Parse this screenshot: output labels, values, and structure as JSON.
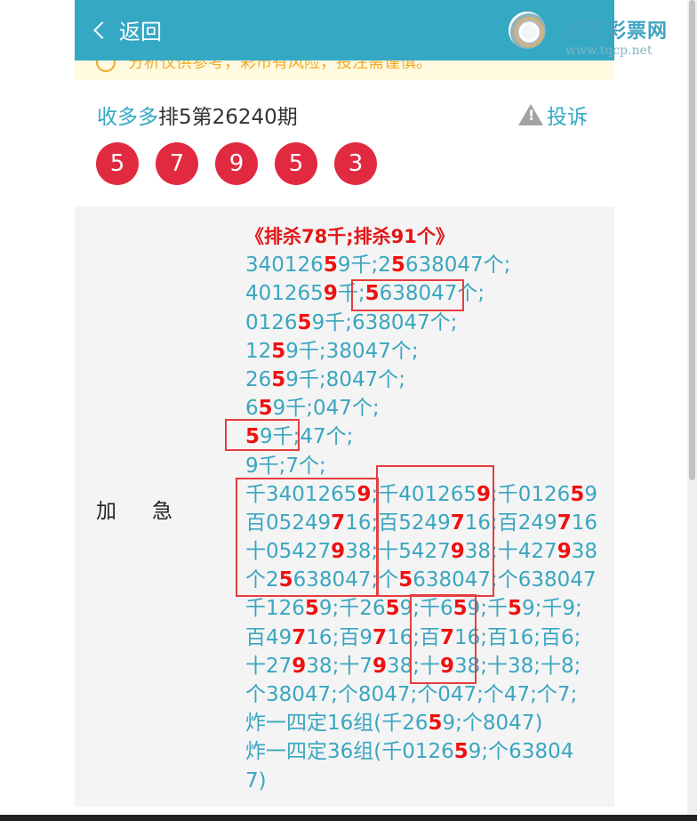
{
  "header": {
    "back_label": "返回",
    "logo_name": "特区彩票网",
    "logo_url": "www.tqcp.net"
  },
  "notice": {
    "text": "分析仅供参考，彩市有风险，投注需谨慎。"
  },
  "issue": {
    "source": "收多多",
    "title": "排5第26240期",
    "complain_label": "投诉",
    "balls": [
      "5",
      "7",
      "9",
      "5",
      "3"
    ]
  },
  "article": {
    "label": "加急",
    "heading": "《排杀78千;排杀91个》",
    "lines": [
      "340126{5}9千;2{5}638047个;",
      "401265{9}千;{5}638047个;",
      "0126{5}9千;638047个;",
      "12{5}9千;38047个;",
      "26{5}9千;8047个;",
      "6{5}9千;047个;",
      "{5}9千;47个;",
      "9千;7个;",
      "千3401265{9};千401265{9};千0126{5}9",
      "百05249{7}16;百5249{7}16;百249{7}16",
      "十05427{9}38;十5427{9}38;十427{9}38",
      "个2{5}638047;个{5}638047;个638047",
      "千126{5}9;千26{5}9;千6{5}9;千{5}9;千9;",
      "百49{7}16;百9{7}16;百{7}16;百16;百6;",
      "十27{9}38;十7{9}38;十{9}38;十38;十8;",
      "个38047;个8047;个047;个47;个7;",
      "炸一四定16组(千26{5}9;个8047)",
      "炸一四定36组(千0126{5}9;个63804",
      "7)"
    ]
  },
  "colors": {
    "accent": "#35a8c4",
    "ball": "#e12940",
    "highlight": "#ee1111",
    "notice": "#f5a623"
  },
  "icons": [
    "back-chevron-icon",
    "logo-icon",
    "warning-icon",
    "notice-icon"
  ]
}
